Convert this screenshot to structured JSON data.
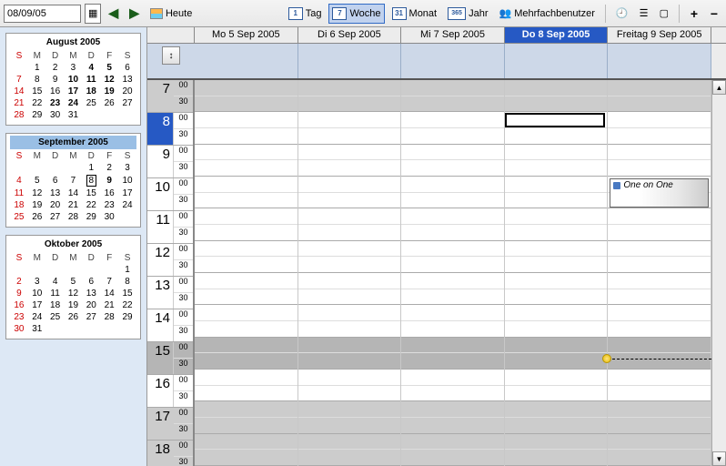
{
  "toolbar": {
    "date_value": "08/09/05",
    "today_label": "Heute",
    "day_label": "Tag",
    "week_label": "Woche",
    "month_label": "Monat",
    "year_label": "Jahr",
    "multiuser_label": "Mehrfachbenutzer",
    "day_num": "1",
    "week_num": "7",
    "month_num": "31",
    "year_num": "365",
    "plus": "+",
    "minus": "−"
  },
  "days": [
    {
      "label": "Mo 5 Sep 2005",
      "selected": false
    },
    {
      "label": "Di 6 Sep 2005",
      "selected": false
    },
    {
      "label": "Mi 7 Sep 2005",
      "selected": false
    },
    {
      "label": "Do 8 Sep 2005",
      "selected": true
    },
    {
      "label": "Freitag 9 Sep 2005",
      "selected": false
    }
  ],
  "hours": [
    {
      "h": "7",
      "m1": "00",
      "m2": "30",
      "off": true
    },
    {
      "h": "8",
      "m1": "00",
      "m2": "30",
      "current": true
    },
    {
      "h": "9",
      "m1": "00",
      "m2": "30"
    },
    {
      "h": "10",
      "m1": "00",
      "m2": "30"
    },
    {
      "h": "11",
      "m1": "00",
      "m2": "30"
    },
    {
      "h": "12",
      "m1": "00",
      "m2": "30"
    },
    {
      "h": "13",
      "m1": "00",
      "m2": "30"
    },
    {
      "h": "14",
      "m1": "00",
      "m2": "30"
    },
    {
      "h": "15",
      "m1": "00",
      "m2": "30",
      "dark": true
    },
    {
      "h": "16",
      "m1": "00",
      "m2": "30"
    },
    {
      "h": "17",
      "m1": "00",
      "m2": "30",
      "off": true
    },
    {
      "h": "18",
      "m1": "00",
      "m2": "30",
      "off": true
    }
  ],
  "event": {
    "title": "One on One",
    "day": 4,
    "hour_index": 3
  },
  "minicals": [
    {
      "title": "August 2005",
      "current": false,
      "dow": [
        "S",
        "M",
        "D",
        "M",
        "D",
        "F",
        "S"
      ],
      "rows": [
        [
          "",
          "1",
          "2",
          "3",
          "4",
          "5",
          "6"
        ],
        [
          "7",
          "8",
          "9",
          "10",
          "11",
          "12",
          "13"
        ],
        [
          "14",
          "15",
          "16",
          "17",
          "18",
          "19",
          "20"
        ],
        [
          "21",
          "22",
          "23",
          "24",
          "25",
          "26",
          "27"
        ],
        [
          "28",
          "29",
          "30",
          "31",
          "",
          "",
          ""
        ]
      ],
      "bold": [
        "4",
        "5",
        "10",
        "11",
        "12",
        "17",
        "18",
        "19",
        "23",
        "24"
      ]
    },
    {
      "title": "September 2005",
      "current": true,
      "dow": [
        "S",
        "M",
        "D",
        "M",
        "D",
        "F",
        "S"
      ],
      "rows": [
        [
          "",
          "",
          "",
          "",
          "1",
          "2",
          "3"
        ],
        [
          "4",
          "5",
          "6",
          "7",
          "8",
          "9",
          "10"
        ],
        [
          "11",
          "12",
          "13",
          "14",
          "15",
          "16",
          "17"
        ],
        [
          "18",
          "19",
          "20",
          "21",
          "22",
          "23",
          "24"
        ],
        [
          "25",
          "26",
          "27",
          "28",
          "29",
          "30",
          ""
        ]
      ],
      "today": "8",
      "bold": [
        "9"
      ]
    },
    {
      "title": "Oktober 2005",
      "current": false,
      "dow": [
        "S",
        "M",
        "D",
        "M",
        "D",
        "F",
        "S"
      ],
      "rows": [
        [
          "",
          "",
          "",
          "",
          "",
          "",
          "1"
        ],
        [
          "2",
          "3",
          "4",
          "5",
          "6",
          "7",
          "8"
        ],
        [
          "9",
          "10",
          "11",
          "12",
          "13",
          "14",
          "15"
        ],
        [
          "16",
          "17",
          "18",
          "19",
          "20",
          "21",
          "22"
        ],
        [
          "23",
          "24",
          "25",
          "26",
          "27",
          "28",
          "29"
        ],
        [
          "30",
          "31",
          "",
          "",
          "",
          "",
          ""
        ]
      ],
      "bold": []
    }
  ],
  "collapse_glyph": "↕",
  "arrows": {
    "left": "◀",
    "right": "▶",
    "up": "▲",
    "down": "▼"
  }
}
